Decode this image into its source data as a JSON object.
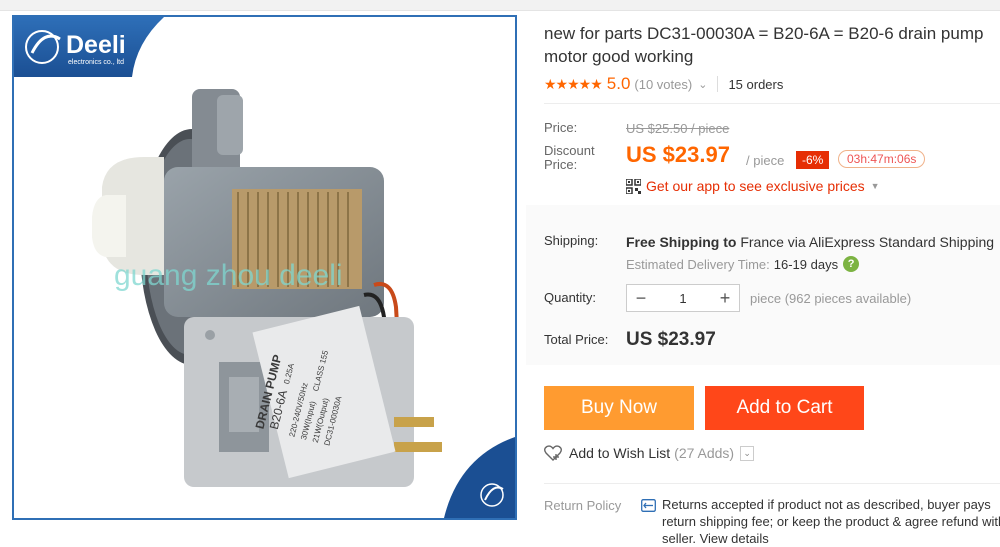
{
  "product": {
    "title": "new for parts DC31-00030A = B20-6A = B20-6 drain pump motor good working",
    "rating": {
      "stars": "★★★★★",
      "score": "5.0",
      "votes": "(10 votes)",
      "orders": "15 orders"
    }
  },
  "image": {
    "brand": "Deeli",
    "brand_sub": "electronics co., ltd",
    "watermark": "guang zhou deeli",
    "label_lines": [
      "DRAIN PUMP",
      "B20-6A",
      "220-240V/50Hz",
      "0.25A",
      "30W(Input)",
      "21W(Output)",
      "CLASS 155",
      "DC31-00030A"
    ]
  },
  "price": {
    "label": "Price:",
    "original": "US $25.50 / piece",
    "discount_label": "Discount Price:",
    "current": "US $23.97",
    "unit": "/ piece",
    "discount_pct": "-6%",
    "countdown": "03h:47m:06s",
    "app_promo": "Get our app to see exclusive prices"
  },
  "shipping": {
    "label": "Shipping:",
    "free": "Free Shipping",
    "to_prefix": "to",
    "destination": "France via AliExpress Standard Shipping",
    "estimate_label": "Estimated Delivery Time:",
    "estimate_days": "16-19 days",
    "help": "?"
  },
  "quantity": {
    "label": "Quantity:",
    "value": "1",
    "minus": "−",
    "plus": "+",
    "available": "piece (962 pieces available)"
  },
  "total": {
    "label": "Total Price:",
    "value": "US $23.97"
  },
  "actions": {
    "buy_now": "Buy Now",
    "add_to_cart": "Add to Cart",
    "wishlist": "Add to Wish List",
    "wishlist_count": "(27 Adds)"
  },
  "return_policy": {
    "label": "Return Policy",
    "text": "Returns accepted if product not as described, buyer pays return shipping fee; or keep the product & agree refund with seller. View details"
  },
  "colors": {
    "accent": "#ff6600",
    "buy": "#ff9b30",
    "cart": "#ff4719",
    "badge": "#e62e04"
  }
}
